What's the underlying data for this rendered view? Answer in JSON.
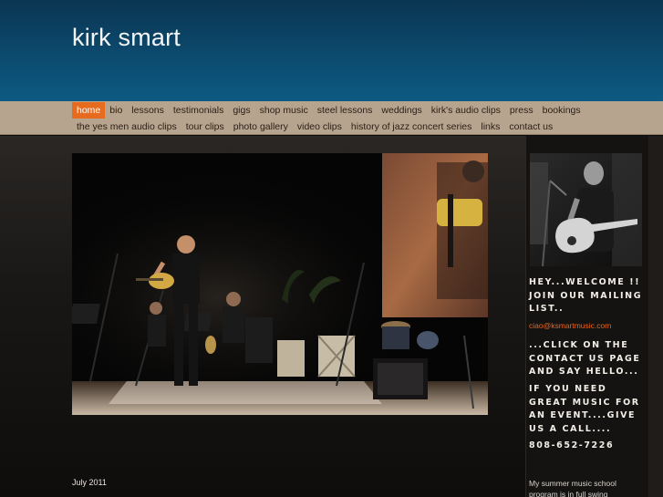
{
  "site": {
    "title": "kirk smart"
  },
  "nav": {
    "row1": [
      {
        "label": "home",
        "active": true
      },
      {
        "label": "bio"
      },
      {
        "label": "lessons"
      },
      {
        "label": "testimonials"
      },
      {
        "label": "gigs"
      },
      {
        "label": "shop music"
      },
      {
        "label": "steel lessons"
      },
      {
        "label": "weddings"
      },
      {
        "label": "kirk's audio clips"
      },
      {
        "label": "press"
      },
      {
        "label": "bookings"
      }
    ],
    "row2": [
      {
        "label": "the yes men audio clips"
      },
      {
        "label": "tour clips"
      },
      {
        "label": "photo gallery"
      },
      {
        "label": "video clips"
      },
      {
        "label": "history of jazz concert series"
      },
      {
        "label": "links"
      },
      {
        "label": "contact us"
      }
    ]
  },
  "main": {
    "date": "July 2011"
  },
  "sidebar": {
    "welcome": "HEY...WELCOME !! JOIN OUR MAILING LIST..",
    "email": "ciao@ksmartmusic.com",
    "contact": "...CLICK ON THE CONTACT US PAGE AND SAY HELLO...",
    "event": "IF YOU NEED GREAT MUSIC FOR AN EVENT....GIVE US A CALL....",
    "phone": "808-652-7226",
    "school": "My summer music school program is in full swing"
  },
  "colors": {
    "header": "#0c4a6e",
    "nav_bg": "#b7a48f",
    "nav_active": "#e66b1e",
    "link": "#e8651c"
  }
}
